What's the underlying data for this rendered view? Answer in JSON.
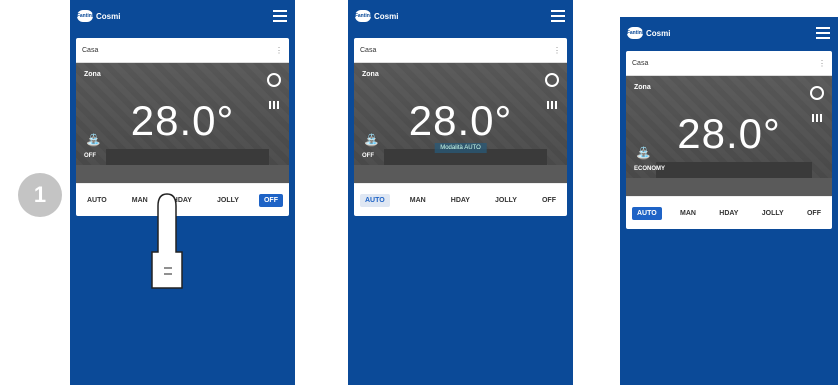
{
  "step": "1",
  "brand": {
    "badge_text": "Fantini",
    "name": "Cosmi"
  },
  "card": {
    "house": "Casa",
    "zone": "Zona",
    "temperature": "28.0°"
  },
  "screens": [
    {
      "mode_label": "OFF",
      "tabs": [
        "AUTO",
        "MAN",
        "HDAY",
        "JOLLY",
        "OFF"
      ],
      "active_tab": 4,
      "message": ""
    },
    {
      "mode_label": "OFF",
      "tabs": [
        "AUTO",
        "MAN",
        "HDAY",
        "JOLLY",
        "OFF"
      ],
      "active_tab": 0,
      "message": "Modalità AUTO"
    },
    {
      "mode_label": "ECONOMY",
      "tabs": [
        "AUTO",
        "MAN",
        "HDAY",
        "JOLLY",
        "OFF"
      ],
      "active_tab": 0,
      "message": ""
    }
  ],
  "colors": {
    "background": "#0b4a98",
    "active_tab": "#1e63c6"
  },
  "icons": [
    "hamburger-icon",
    "gear-icon",
    "signal-icon",
    "tap-icon",
    "finger-icon"
  ]
}
